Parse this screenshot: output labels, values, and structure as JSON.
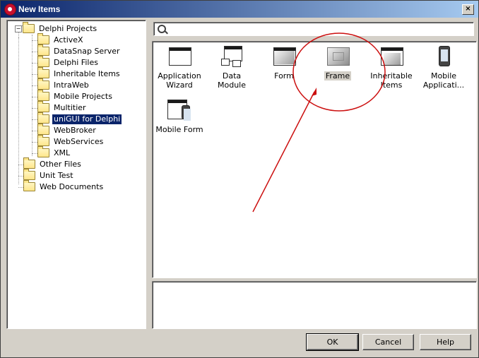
{
  "window": {
    "title": "New Items",
    "close_glyph": "×"
  },
  "tree": {
    "root": "Delphi Projects",
    "expander": "−",
    "children": [
      "ActiveX",
      "DataSnap Server",
      "Delphi Files",
      "Inheritable Items",
      "IntraWeb",
      "Mobile Projects",
      "Multitier",
      "uniGUI for Delphi",
      "WebBroker",
      "WebServices",
      "XML"
    ],
    "selected": "uniGUI for Delphi",
    "others": [
      "Other Files",
      "Unit Test",
      "Web Documents"
    ]
  },
  "search": {
    "value": "",
    "placeholder": ""
  },
  "items": [
    {
      "line1": "Application",
      "line2": "Wizard"
    },
    {
      "line1": "Data Module",
      "line2": ""
    },
    {
      "line1": "Form",
      "line2": ""
    },
    {
      "line1": "Frame",
      "line2": ""
    },
    {
      "line1": "Inheritable",
      "line2": "Items"
    },
    {
      "line1": "Mobile",
      "line2": "Applicati..."
    },
    {
      "line1": "Mobile Form",
      "line2": ""
    }
  ],
  "selected_item": "Frame",
  "buttons": {
    "ok": "OK",
    "cancel": "Cancel",
    "help": "Help"
  },
  "colors": {
    "annotation": "#cc1010",
    "selection": "#0a246a",
    "title_start": "#0a246a",
    "title_end": "#a6caf0"
  }
}
